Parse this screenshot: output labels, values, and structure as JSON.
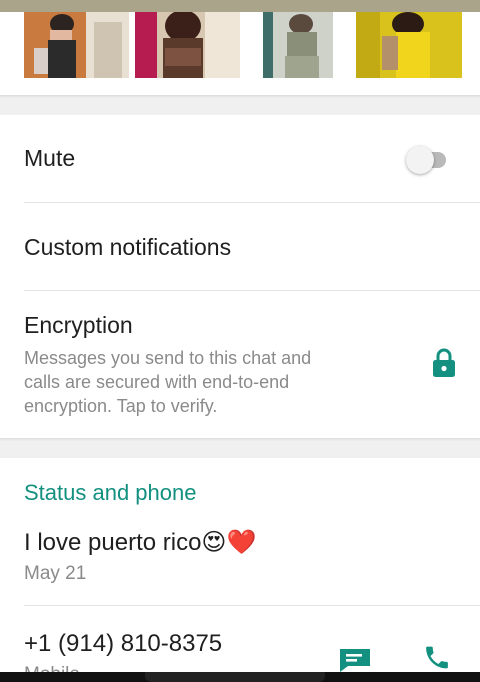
{
  "colors": {
    "accent": "#13907f",
    "text": "#1f1f1f",
    "secondary": "#8a8a8a"
  },
  "media": [
    {
      "name": "media-thumbnail-1"
    },
    {
      "name": "media-thumbnail-2"
    },
    {
      "name": "media-thumbnail-3"
    },
    {
      "name": "media-thumbnail-4"
    }
  ],
  "settings": {
    "mute": {
      "label": "Mute",
      "enabled": false
    },
    "custom_notifications": {
      "label": "Custom notifications"
    },
    "encryption": {
      "label": "Encryption",
      "description_line1": "Messages you send to this chat and",
      "description_line2": "calls are secured with end-to-end",
      "description_line3": "encryption. Tap to verify.",
      "icon": "lock-icon"
    }
  },
  "status_section": {
    "title": "Status and phone",
    "status_text": "I love puerto rico😍❤️",
    "status_date": "May 21",
    "phone": "+1 (914) 810-8375",
    "phone_label": "Mobile",
    "message_icon": "message-icon",
    "call_icon": "phone-icon"
  }
}
